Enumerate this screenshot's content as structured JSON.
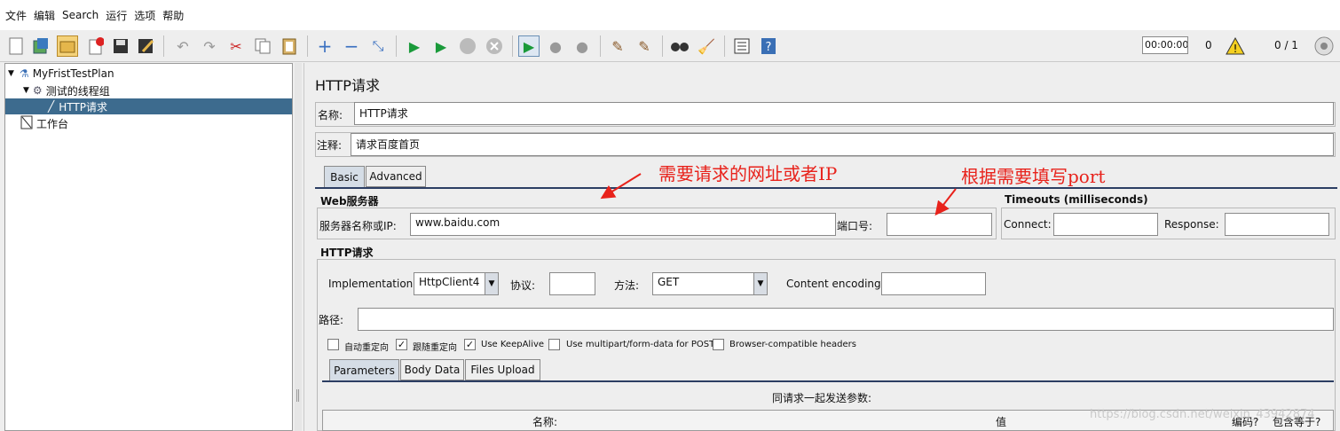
{
  "menu": [
    "文件",
    "编辑",
    "Search",
    "运行",
    "选项",
    "帮助"
  ],
  "toolbar": {
    "timer": "00:00:00",
    "error_count": "0",
    "thread_count": "0 / 1"
  },
  "tree": {
    "plan": "MyFristTestPlan",
    "thread_group": "测试的线程组",
    "sampler": "HTTP请求",
    "workbench": "工作台"
  },
  "panel": {
    "title": "HTTP请求",
    "name_label": "名称:",
    "name_value": "HTTP请求",
    "comment_label": "注释:",
    "comment_value": "请求百度首页",
    "tabs": [
      "Basic",
      "Advanced"
    ],
    "web_server": {
      "title": "Web服务器",
      "server_label": "服务器名称或IP:",
      "server_value": "www.baidu.com",
      "port_label": "端口号:",
      "port_value": ""
    },
    "timeouts": {
      "title": "Timeouts (milliseconds)",
      "connect_label": "Connect:",
      "response_label": "Response:"
    },
    "http_request": {
      "title": "HTTP请求",
      "impl_label": "Implementation:",
      "impl_value": "HttpClient4",
      "protocol_label": "协议:",
      "method_label": "方法:",
      "method_value": "GET",
      "encoding_label": "Content encoding:",
      "path_label": "路径:"
    },
    "checkboxes": [
      {
        "label": "自动重定向",
        "checked": false
      },
      {
        "label": "跟随重定向",
        "checked": true
      },
      {
        "label": "Use KeepAlive",
        "checked": true
      },
      {
        "label": "Use multipart/form-data for POST",
        "checked": false
      },
      {
        "label": "Browser-compatible headers",
        "checked": false
      }
    ],
    "subtabs": [
      "Parameters",
      "Body Data",
      "Files Upload"
    ],
    "params_caption": "同请求一起发送参数:",
    "columns": [
      "名称:",
      "值",
      "编码?",
      "包含等于?"
    ]
  },
  "annotations": {
    "left": "需要请求的网址或者IP",
    "right": "根据需要填写port"
  },
  "watermark": "https://blog.csdn.net/weixin_43942874",
  "colors": {
    "selection": "#3d6b8e",
    "annotation": "#e8221b",
    "rule": "#2c3e63"
  }
}
